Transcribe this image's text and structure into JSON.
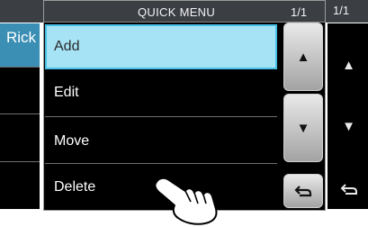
{
  "background": {
    "page_indicator": "1/1",
    "list": [
      {
        "label": "Rick",
        "selected": true
      },
      {
        "label": ""
      },
      {
        "label": ""
      },
      {
        "label": ""
      }
    ],
    "scroll_icons": {
      "up": "triangle-up-icon",
      "down": "triangle-down-icon",
      "back": "return-icon"
    }
  },
  "quick_menu": {
    "title": "QUICK MENU",
    "page_indicator": "1/1",
    "items": [
      {
        "label": "Add",
        "selected": true
      },
      {
        "label": "Edit"
      },
      {
        "label": "Move"
      },
      {
        "label": "Delete"
      }
    ],
    "scroll_icons": {
      "up": "triangle-up-icon",
      "down": "triangle-down-icon",
      "back": "return-icon"
    }
  },
  "colors": {
    "header": "#3b3f44",
    "selected_fill": "#a5e3f5",
    "selected_border": "#47bfe6",
    "background_selected": "#3b8fb4",
    "list_background": "#000000"
  },
  "pointer_icon": "touch-hand-icon"
}
